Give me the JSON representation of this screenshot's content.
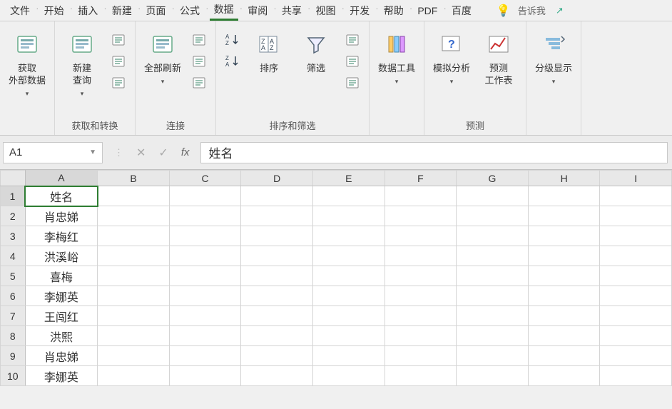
{
  "menu": {
    "items": [
      "文件",
      "开始",
      "插入",
      "新建",
      "页面",
      "公式",
      "数据",
      "审阅",
      "共享",
      "视图",
      "开发",
      "帮助",
      "PDF",
      "百度"
    ],
    "active_index": 6,
    "tell_me": "告诉我"
  },
  "ribbon": {
    "groups": [
      {
        "label": "",
        "buttons": [
          {
            "name": "get-external-data",
            "label": "获取\n外部数据",
            "dropdown": true
          }
        ]
      },
      {
        "label": "获取和转换",
        "buttons": [
          {
            "name": "new-query",
            "label": "新建\n查询",
            "dropdown": true
          }
        ],
        "side_icons": [
          "table-icon",
          "recent-icon",
          "cube-icon"
        ]
      },
      {
        "label": "连接",
        "buttons": [
          {
            "name": "refresh-all",
            "label": "全部刷新",
            "dropdown": true
          }
        ],
        "side_icons": [
          "connections-icon",
          "properties-icon",
          "edit-links-icon"
        ]
      },
      {
        "label": "排序和筛选",
        "buttons": [
          {
            "name": "sort",
            "label": "排序"
          },
          {
            "name": "filter",
            "label": "筛选"
          }
        ],
        "pre_icons": [
          "sort-asc-icon",
          "sort-desc-icon"
        ],
        "side_icons": [
          "clear-filter-icon",
          "reapply-icon",
          "advanced-icon"
        ]
      },
      {
        "label": "",
        "buttons": [
          {
            "name": "data-tools",
            "label": "数据工具",
            "dropdown": true
          }
        ]
      },
      {
        "label": "预测",
        "buttons": [
          {
            "name": "what-if",
            "label": "模拟分析",
            "dropdown": true
          },
          {
            "name": "forecast-sheet",
            "label": "预测\n工作表"
          }
        ]
      },
      {
        "label": "",
        "buttons": [
          {
            "name": "group-outline",
            "label": "分级显示",
            "dropdown": true
          }
        ]
      }
    ]
  },
  "formula_bar": {
    "name_box": "A1",
    "fx": "fx",
    "value": "姓名"
  },
  "sheet": {
    "columns": [
      "A",
      "B",
      "C",
      "D",
      "E",
      "F",
      "G",
      "H",
      "I"
    ],
    "active_col": 0,
    "active_row": 0,
    "rows": [
      [
        "姓名",
        "",
        "",
        "",
        "",
        "",
        "",
        "",
        ""
      ],
      [
        "肖忠娣",
        "",
        "",
        "",
        "",
        "",
        "",
        "",
        ""
      ],
      [
        "李梅红",
        "",
        "",
        "",
        "",
        "",
        "",
        "",
        ""
      ],
      [
        "洪溪峪",
        "",
        "",
        "",
        "",
        "",
        "",
        "",
        ""
      ],
      [
        "喜梅",
        "",
        "",
        "",
        "",
        "",
        "",
        "",
        ""
      ],
      [
        "李娜英",
        "",
        "",
        "",
        "",
        "",
        "",
        "",
        ""
      ],
      [
        "王闯红",
        "",
        "",
        "",
        "",
        "",
        "",
        "",
        ""
      ],
      [
        "洪熙",
        "",
        "",
        "",
        "",
        "",
        "",
        "",
        ""
      ],
      [
        "肖忠娣",
        "",
        "",
        "",
        "",
        "",
        "",
        "",
        ""
      ],
      [
        "李娜英",
        "",
        "",
        "",
        "",
        "",
        "",
        "",
        ""
      ]
    ]
  }
}
